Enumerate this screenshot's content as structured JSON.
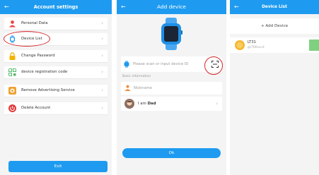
{
  "screen1": {
    "title": "Account settings",
    "back_glyph": "←",
    "chevron": "›",
    "items": [
      {
        "label": "Personal Data",
        "icon": "person-icon",
        "color": "#e44a4a"
      },
      {
        "label": "Device List",
        "icon": "watch-icon",
        "color": "#1e9bf0"
      },
      {
        "label": "Change Password",
        "icon": "lock-icon",
        "color": "#f2b400"
      },
      {
        "label": "device registration code",
        "icon": "qr-code-icon",
        "color": "#53b96a"
      },
      {
        "label": "Remove Advertising Service",
        "icon": "ad-icon",
        "color": "#f0a030"
      },
      {
        "label": "Delete Account",
        "icon": "power-icon",
        "color": "#e23b3b"
      }
    ],
    "exit_label": "Exit"
  },
  "screen2": {
    "title": "Add device",
    "back_glyph": "←",
    "device_placeholder": "Please scan or input device ID",
    "section_label": "Basic information",
    "nickname_placeholder": "Nickname",
    "relation_prefix": "I am",
    "relation_value": "Dad",
    "chevron": "›",
    "ok_label": "Ok"
  },
  "screen3": {
    "title": "Device List",
    "back_glyph": "←",
    "add_label": "+ Add Device",
    "devices": [
      {
        "name": "LT31",
        "id": "gs766svcd"
      }
    ]
  },
  "colors": {
    "accent": "#1e9bf0",
    "highlight": "#d8262a",
    "online": "#7fd17f"
  }
}
